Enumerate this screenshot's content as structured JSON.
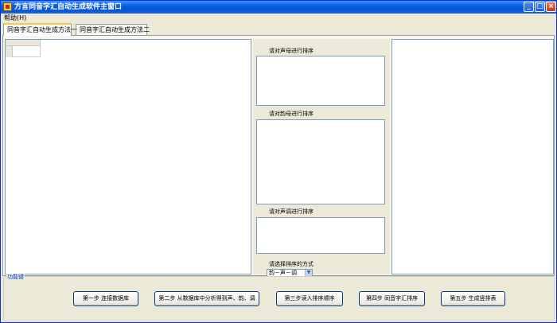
{
  "window": {
    "title": "方言同音字汇自动生成软件主窗口",
    "controls": {
      "minimize": "_",
      "maximize": "□",
      "close": "×"
    }
  },
  "menu": {
    "help": "帮助(H)"
  },
  "tabs": [
    {
      "label": "同音字汇自动生成方法一",
      "active": true
    },
    {
      "label": "同音字汇自动生成方法二",
      "active": false
    }
  ],
  "sorting": {
    "initial_label": "请对声母进行排序",
    "final_label": "请对韵母进行排序",
    "tone_label": "请对声调进行排序",
    "method_label": "请选择排序的方式",
    "method_selected": "韵－声－调"
  },
  "function_keys": {
    "legend": "功能键",
    "buttons": [
      {
        "label": "第一步 连接数据库"
      },
      {
        "label": "第二步 从数据库中分析得到声、韵、调"
      },
      {
        "label": "第三步读入排序顺序"
      },
      {
        "label": "第四步 同音字汇排序"
      },
      {
        "label": "第五步 生成竖排表"
      }
    ]
  },
  "colors": {
    "titlebar": "#0553d7",
    "window_bg": "#ece9d8",
    "active_tab_accent": "#ffc83c",
    "legend_text": "#0046d5"
  }
}
